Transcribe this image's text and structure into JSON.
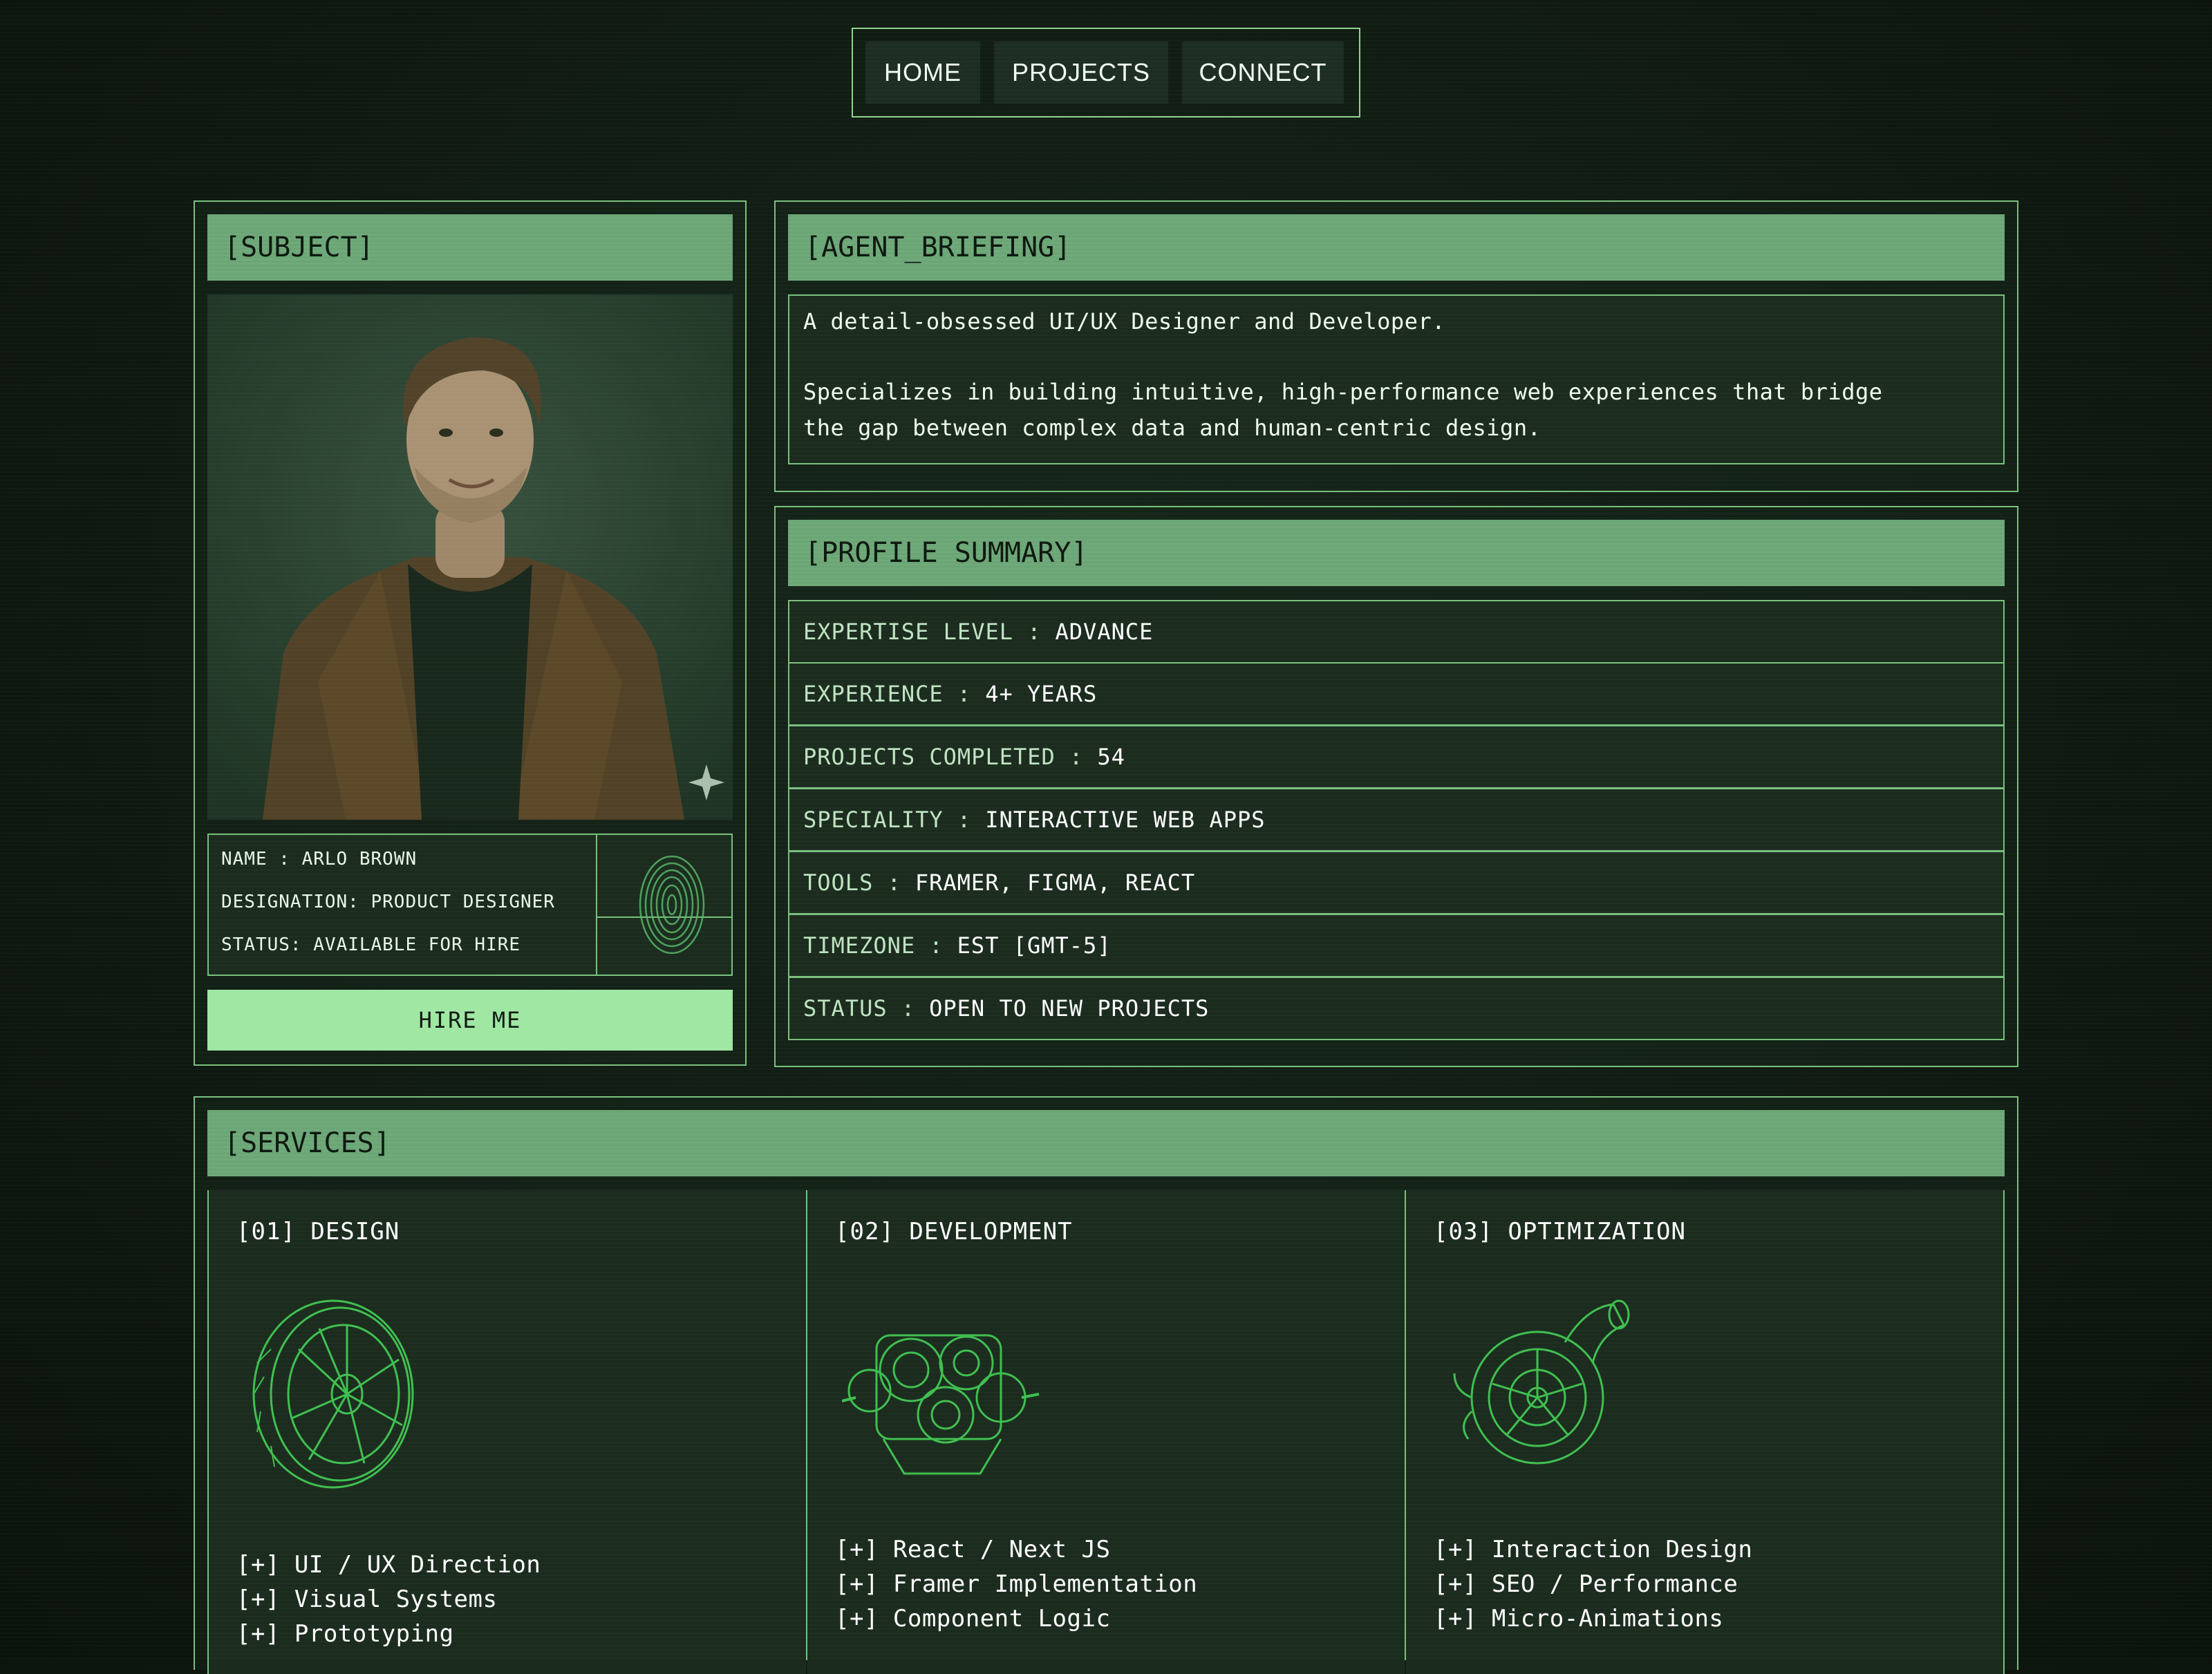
{
  "nav": {
    "items": [
      "HOME",
      "PROJECTS",
      "CONNECT"
    ]
  },
  "subject": {
    "header": "[SUBJECT]",
    "name_label": "NAME :",
    "name_value": "ARLO BROWN",
    "designation_label": "DESIGNATION:",
    "designation_value": "PRODUCT DESIGNER",
    "status_label": "STATUS:",
    "status_value": "AVAILABLE FOR HIRE",
    "hire_button": "HIRE ME"
  },
  "briefing": {
    "header": "[AGENT_BRIEFING]",
    "line1": "A detail-obsessed UI/UX Designer and Developer.",
    "line2": "Specializes in building intuitive, high-performance web experiences that bridge",
    "line3": "the gap between complex data and human-centric design."
  },
  "profile": {
    "header": "[PROFILE SUMMARY]",
    "rows": [
      {
        "key": "EXPERTISE LEVEL :",
        "value": "ADVANCE"
      },
      {
        "key": "EXPERIENCE :",
        "value": "4+ YEARS"
      },
      {
        "key": "PROJECTS COMPLETED :",
        "value": "54"
      },
      {
        "key": "SPECIALITY :",
        "value": "INTERACTIVE WEB APPS"
      },
      {
        "key": "TOOLS :",
        "value": "FRAMER, FIGMA, REACT"
      },
      {
        "key": "TIMEZONE :",
        "value": "EST [GMT-5]"
      },
      {
        "key": "STATUS :",
        "value": "OPEN TO NEW PROJECTS"
      }
    ]
  },
  "services": {
    "header": "[SERVICES]",
    "columns": [
      {
        "title": "[01] DESIGN",
        "icon": "wheel-wireframe-icon",
        "items": [
          "[+] UI / UX Direction",
          "[+] Visual Systems",
          "[+] Prototyping"
        ]
      },
      {
        "title": "[02] DEVELOPMENT",
        "icon": "gearbox-wireframe-icon",
        "items": [
          "[+] React / Next JS",
          "[+] Framer Implementation",
          "[+] Component Logic"
        ]
      },
      {
        "title": "[03] OPTIMIZATION",
        "icon": "turbocharger-wireframe-icon",
        "items": [
          "[+] Interaction Design",
          "[+] SEO / Performance",
          "[+] Micro-Animations"
        ]
      }
    ]
  },
  "colors": {
    "accent": "#78c07c",
    "header_bar": "#6aa575",
    "button": "#9fe7a2",
    "wireframe": "#3fbf4f"
  }
}
